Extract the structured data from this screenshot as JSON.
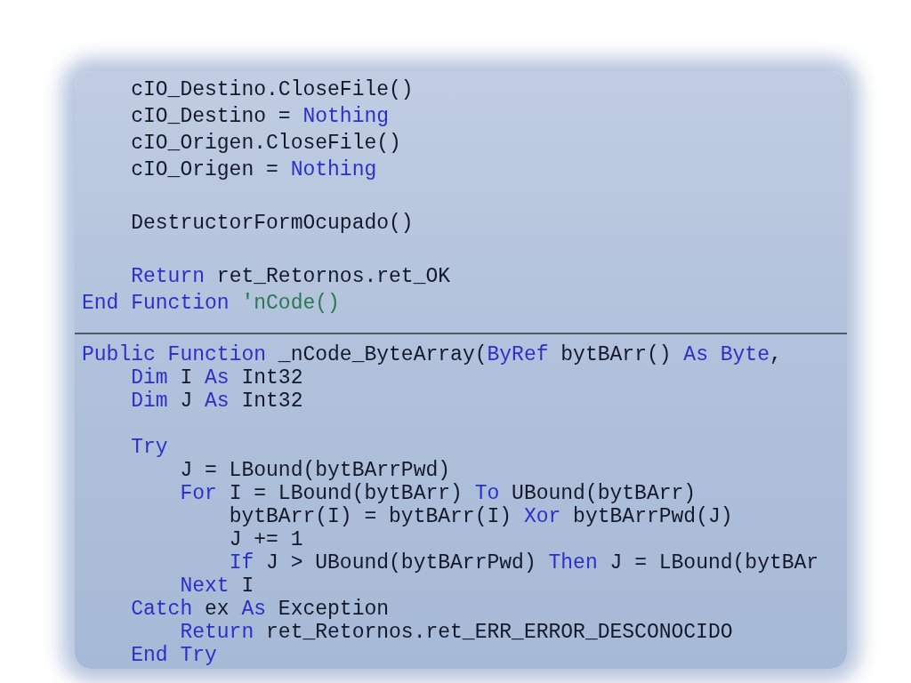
{
  "editor": {
    "sections": [
      {
        "body": [
          {
            "kind": "code",
            "tokens": [
              {
                "kind": "plain",
                "text": "cIO_Destino.CloseFile()"
              }
            ]
          },
          {
            "kind": "code",
            "tokens": [
              {
                "kind": "plain",
                "text": "cIO_Destino = "
              },
              {
                "kind": "keyword",
                "text": "Nothing"
              }
            ]
          },
          {
            "kind": "code",
            "tokens": [
              {
                "kind": "plain",
                "text": "cIO_Origen.CloseFile()"
              }
            ]
          },
          {
            "kind": "code",
            "tokens": [
              {
                "kind": "plain",
                "text": "cIO_Origen = "
              },
              {
                "kind": "keyword",
                "text": "Nothing"
              }
            ]
          },
          {
            "kind": "blank"
          },
          {
            "kind": "code",
            "tokens": [
              {
                "kind": "plain",
                "text": "DestructorFormOcupado()"
              }
            ]
          },
          {
            "kind": "blank"
          },
          {
            "kind": "code",
            "tokens": [
              {
                "kind": "keyword",
                "text": "Return"
              },
              {
                "kind": "plain",
                "text": " ret_Retornos.ret_OK"
              }
            ]
          }
        ],
        "end_line": {
          "kind": "code",
          "tokens": [
            {
              "kind": "keyword",
              "text": "End Function "
            },
            {
              "kind": "comment",
              "text": "'nCode()"
            }
          ]
        }
      },
      {
        "start_line": {
          "kind": "code",
          "tokens": [
            {
              "kind": "keyword",
              "text": "Public Function"
            },
            {
              "kind": "plain",
              "text": " _nCode_ByteArray("
            },
            {
              "kind": "keyword",
              "text": "ByRef"
            },
            {
              "kind": "plain",
              "text": " bytBArr() "
            },
            {
              "kind": "keyword",
              "text": "As Byte"
            },
            {
              "kind": "plain",
              "text": ","
            }
          ]
        },
        "body": [
          {
            "kind": "code",
            "tokens": [
              {
                "kind": "keyword",
                "text": "Dim"
              },
              {
                "kind": "plain",
                "text": " I "
              },
              {
                "kind": "keyword",
                "text": "As"
              },
              {
                "kind": "plain",
                "text": " Int32"
              }
            ]
          },
          {
            "kind": "code",
            "tokens": [
              {
                "kind": "keyword",
                "text": "Dim"
              },
              {
                "kind": "plain",
                "text": " J "
              },
              {
                "kind": "keyword",
                "text": "As"
              },
              {
                "kind": "plain",
                "text": " Int32"
              }
            ]
          },
          {
            "kind": "blank"
          },
          {
            "kind": "code",
            "tokens": [
              {
                "kind": "keyword",
                "text": "Try"
              }
            ],
            "children": [
              {
                "kind": "code",
                "tokens": [
                  {
                    "kind": "plain",
                    "text": "J = LBound(bytBArrPwd)"
                  }
                ]
              },
              {
                "kind": "code",
                "tokens": [
                  {
                    "kind": "keyword",
                    "text": "For"
                  },
                  {
                    "kind": "plain",
                    "text": " I = LBound(bytBArr) "
                  },
                  {
                    "kind": "keyword",
                    "text": "To"
                  },
                  {
                    "kind": "plain",
                    "text": " UBound(bytBArr)"
                  }
                ],
                "children": [
                  {
                    "kind": "code",
                    "tokens": [
                      {
                        "kind": "plain",
                        "text": "bytBArr(I) = bytBArr(I) "
                      },
                      {
                        "kind": "keyword",
                        "text": "Xor"
                      },
                      {
                        "kind": "plain",
                        "text": " bytBArrPwd(J)"
                      }
                    ]
                  },
                  {
                    "kind": "code",
                    "tokens": [
                      {
                        "kind": "plain",
                        "text": "J += 1"
                      }
                    ]
                  },
                  {
                    "kind": "code",
                    "tokens": [
                      {
                        "kind": "keyword",
                        "text": "If"
                      },
                      {
                        "kind": "plain",
                        "text": " J > UBound(bytBArrPwd) "
                      },
                      {
                        "kind": "keyword",
                        "text": "Then"
                      },
                      {
                        "kind": "plain",
                        "text": " J = LBound(bytBAr"
                      }
                    ]
                  }
                ]
              },
              {
                "kind": "code",
                "tokens": [
                  {
                    "kind": "keyword",
                    "text": "Next"
                  },
                  {
                    "kind": "plain",
                    "text": " I"
                  }
                ]
              }
            ]
          },
          {
            "kind": "code",
            "tokens": [
              {
                "kind": "keyword",
                "text": "Catch"
              },
              {
                "kind": "plain",
                "text": " ex "
              },
              {
                "kind": "keyword",
                "text": "As"
              },
              {
                "kind": "plain",
                "text": " Exception"
              }
            ],
            "children": [
              {
                "kind": "code",
                "tokens": [
                  {
                    "kind": "keyword",
                    "text": "Return"
                  },
                  {
                    "kind": "plain",
                    "text": " ret_Retornos.ret_ERR_ERROR_DESCONOCIDO"
                  }
                ]
              }
            ]
          },
          {
            "kind": "code",
            "tokens": [
              {
                "kind": "keyword",
                "text": "End Try"
              }
            ]
          }
        ]
      }
    ]
  }
}
